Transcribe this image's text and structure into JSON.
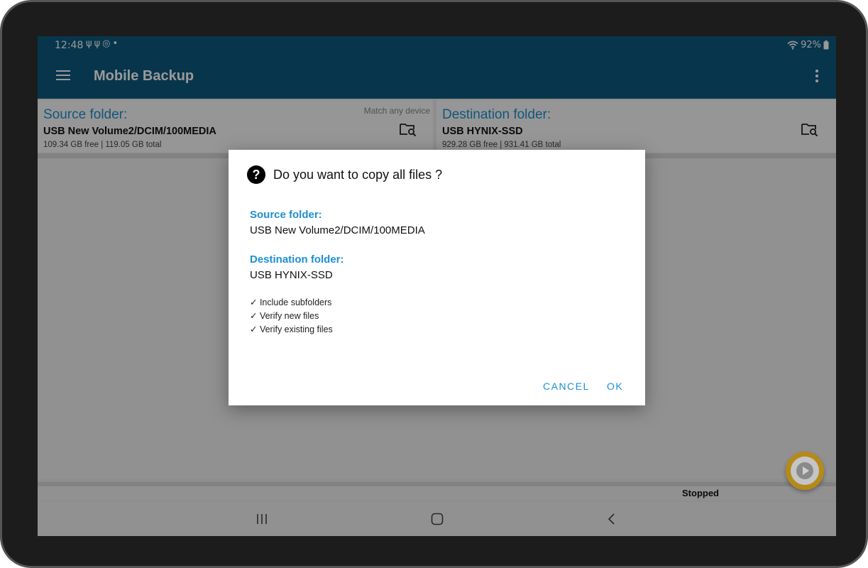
{
  "status_bar": {
    "time": "12:48",
    "notification_icons": [
      "usb-icon",
      "usb-icon",
      "sync-icon",
      "dot-icon"
    ],
    "battery_percent": "92%"
  },
  "app_bar": {
    "title": "Mobile Backup"
  },
  "source_panel": {
    "heading": "Source folder:",
    "path": "USB New Volume2/DCIM/100MEDIA",
    "storage_info": "109.34 GB free | 119.05 GB total",
    "match_label": "Match any device"
  },
  "destination_panel": {
    "heading": "Destination folder:",
    "path": "USB HYNIX-SSD",
    "storage_info": "929.28 GB free | 931.41 GB total"
  },
  "status_text": "Stopped",
  "dialog": {
    "title": "Do you want to copy all files ?",
    "source_label": "Source folder:",
    "source_value": "USB New Volume2/DCIM/100MEDIA",
    "destination_label": "Destination folder:",
    "destination_value": "USB HYNIX-SSD",
    "options": [
      "✓ Include subfolders",
      "✓ Verify new files",
      "✓ Verify existing files"
    ],
    "cancel_label": "CANCEL",
    "ok_label": "OK"
  },
  "colors": {
    "app_bar": "#0d5a7f",
    "accent": "#1e8fd0",
    "fab": "#b58a1b"
  }
}
